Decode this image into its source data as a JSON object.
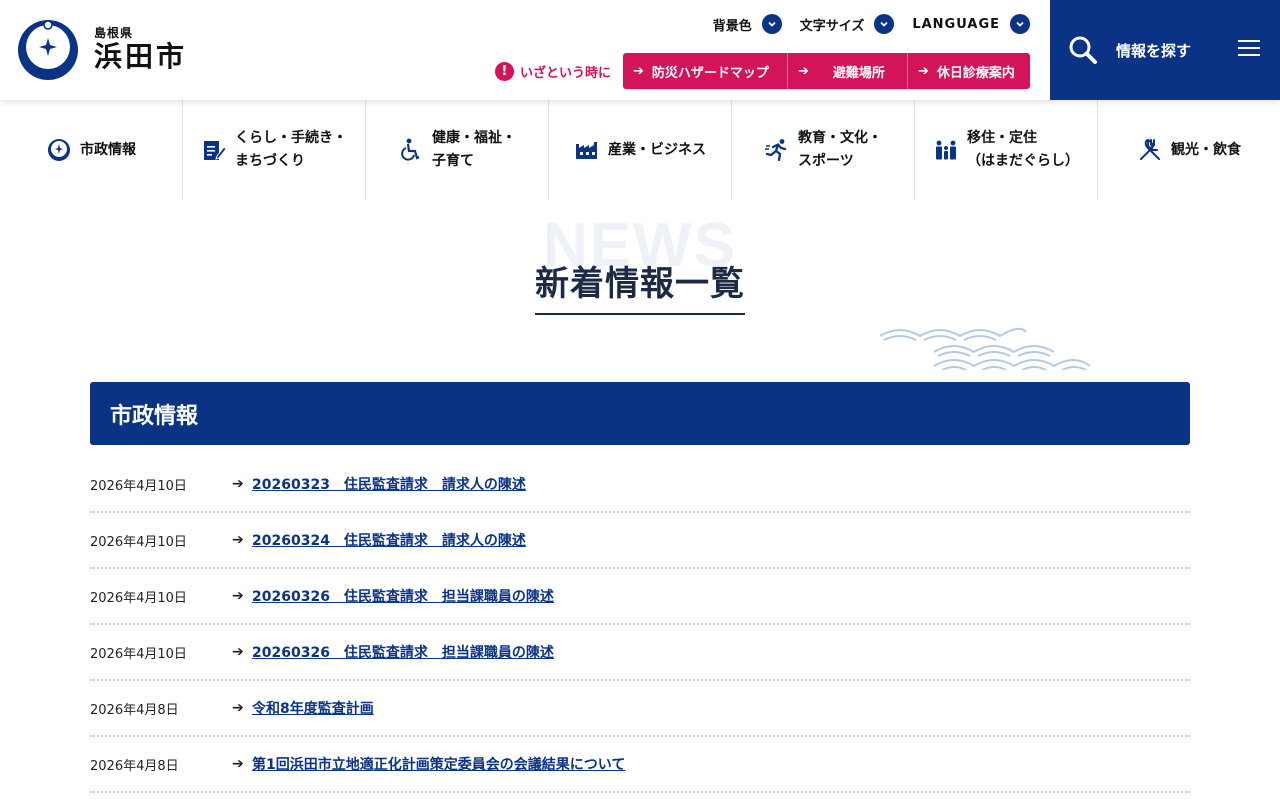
{
  "header": {
    "logo": {
      "prefecture": "島根県",
      "city": "浜田市"
    },
    "utilities": [
      {
        "label": "背景色"
      },
      {
        "label": "文字サイズ"
      },
      {
        "label": "LANGUAGE"
      }
    ],
    "emergency": {
      "label": "いざという時に",
      "buttons": [
        {
          "label": "防災ハザードマップ"
        },
        {
          "label": "避難場所"
        },
        {
          "label": "休日診療案内"
        }
      ]
    },
    "search_label": "情報を探す"
  },
  "nav": [
    {
      "label": "市政情報",
      "icon": "city-emblem-icon"
    },
    {
      "label": "くらし・手続き・\nまちづくり",
      "icon": "form-pencil-icon"
    },
    {
      "label": "健康・福祉・\n子育て",
      "icon": "wheelchair-icon"
    },
    {
      "label": "産業・ビジネス",
      "icon": "factory-icon"
    },
    {
      "label": "教育・文化・\nスポーツ",
      "icon": "runner-icon"
    },
    {
      "label": "移住・定住\n（はまだぐらし）",
      "icon": "family-icon"
    },
    {
      "label": "観光・飲食",
      "icon": "fork-knife-icon"
    }
  ],
  "page": {
    "bg_text": "NEWS",
    "title": "新着情報一覧"
  },
  "category": {
    "title": "市政情報",
    "items": [
      {
        "date": "2026年4月10日",
        "title": "20260323　住民監査請求　請求人の陳述"
      },
      {
        "date": "2026年4月10日",
        "title": "20260324　住民監査請求　請求人の陳述"
      },
      {
        "date": "2026年4月10日",
        "title": "20260326　住民監査請求　担当課職員の陳述"
      },
      {
        "date": "2026年4月10日",
        "title": "20260326　住民監査請求　担当課職員の陳述"
      },
      {
        "date": "2026年4月8日",
        "title": "令和8年度監査計画"
      },
      {
        "date": "2026年4月8日",
        "title": "第1回浜田市立地適正化計画策定委員会の会議結果について"
      }
    ]
  },
  "colors": {
    "primary": "#0a3386",
    "emergency": "#d4145a"
  }
}
